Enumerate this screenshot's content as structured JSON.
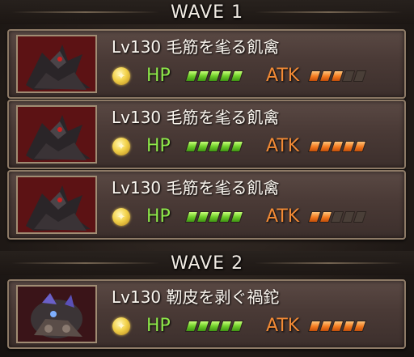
{
  "waves": [
    {
      "label": "WAVE 1",
      "enemies": [
        {
          "name": "Lv130 毛筋を毟る飢禽",
          "element": "light",
          "hp_label": "HP",
          "hp_level": 5,
          "atk_label": "ATK",
          "atk_level": 3
        },
        {
          "name": "Lv130 毛筋を毟る飢禽",
          "element": "light",
          "hp_label": "HP",
          "hp_level": 5,
          "atk_label": "ATK",
          "atk_level": 5
        },
        {
          "name": "Lv130 毛筋を毟る飢禽",
          "element": "light",
          "hp_label": "HP",
          "hp_level": 5,
          "atk_label": "ATK",
          "atk_level": 2
        }
      ]
    },
    {
      "label": "WAVE 2",
      "enemies": [
        {
          "name": "Lv130 靭皮を剥ぐ禍鉈",
          "element": "light",
          "hp_label": "HP",
          "hp_level": 5,
          "atk_label": "ATK",
          "atk_level": 5
        }
      ]
    }
  ],
  "gauge_max": 5,
  "colors": {
    "hp": "#6fcf2a",
    "atk": "#f2781e",
    "element_light": "#f2d24a"
  }
}
